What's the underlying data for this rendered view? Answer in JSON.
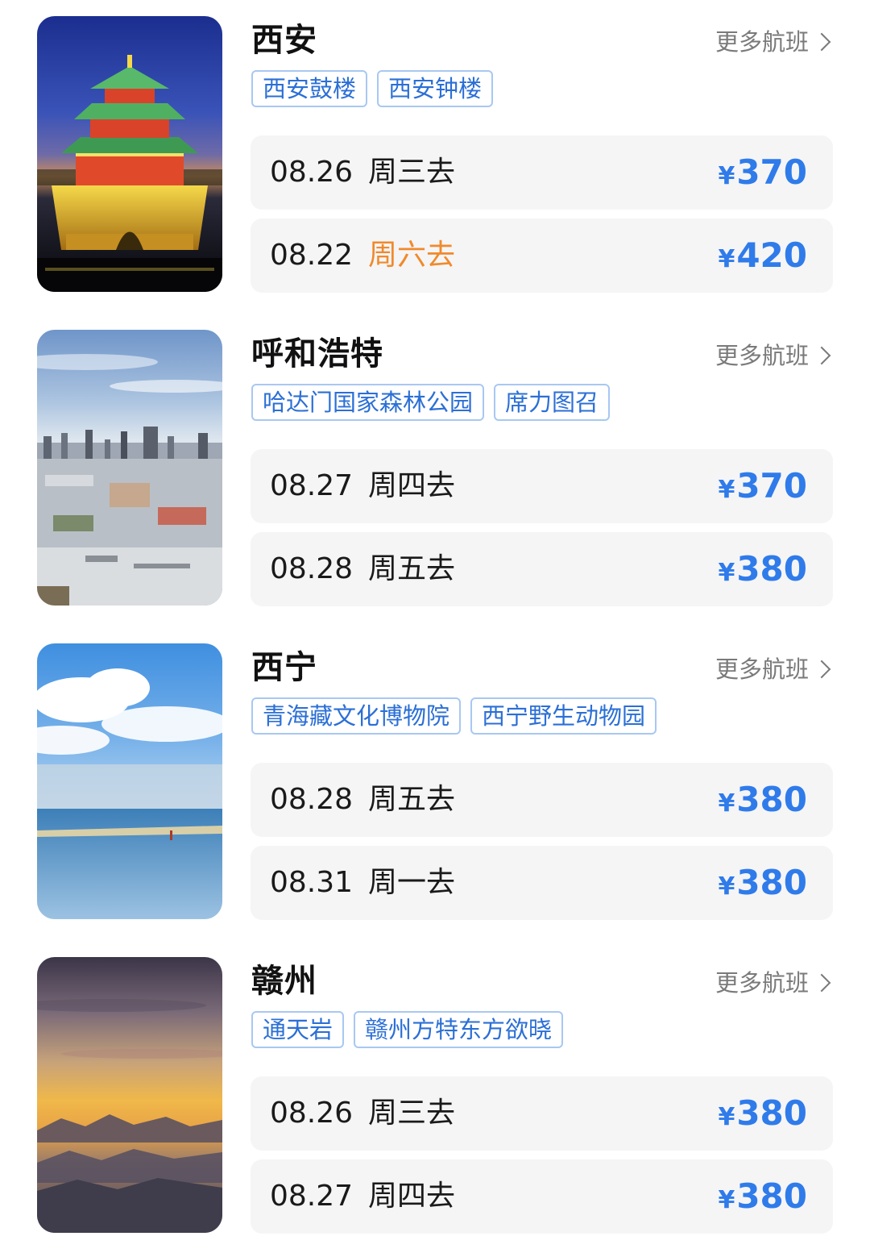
{
  "more_label": "更多航班",
  "colors": {
    "price": "#2f7bea",
    "weekend": "#f08a2c",
    "tag_text": "#2b6fd6",
    "tag_border": "#a8c8f2",
    "card_bg": "#f5f5f6"
  },
  "destinations": [
    {
      "city": "西安",
      "image": "xian-bell-tower-night-photo",
      "tags": [
        "西安鼓楼",
        "西安钟楼"
      ],
      "flights": [
        {
          "date": "08.26",
          "weekday": "周三去",
          "currency": "¥",
          "price": "370",
          "weekend": false
        },
        {
          "date": "08.22",
          "weekday": "周六去",
          "currency": "¥",
          "price": "420",
          "weekend": true
        }
      ]
    },
    {
      "city": "呼和浩特",
      "image": "hohhot-city-skyline-photo",
      "tags": [
        "哈达门国家森林公园",
        "席力图召"
      ],
      "flights": [
        {
          "date": "08.27",
          "weekday": "周四去",
          "currency": "¥",
          "price": "370",
          "weekend": false
        },
        {
          "date": "08.28",
          "weekday": "周五去",
          "currency": "¥",
          "price": "380",
          "weekend": false
        }
      ]
    },
    {
      "city": "西宁",
      "image": "xining-lake-sky-photo",
      "tags": [
        "青海藏文化博物院",
        "西宁野生动物园"
      ],
      "flights": [
        {
          "date": "08.28",
          "weekday": "周五去",
          "currency": "¥",
          "price": "380",
          "weekend": false
        },
        {
          "date": "08.31",
          "weekday": "周一去",
          "currency": "¥",
          "price": "380",
          "weekend": false
        }
      ]
    },
    {
      "city": "赣州",
      "image": "ganzhou-sunset-mountains-photo",
      "tags": [
        "通天岩",
        "赣州方特东方欲晓"
      ],
      "flights": [
        {
          "date": "08.26",
          "weekday": "周三去",
          "currency": "¥",
          "price": "380",
          "weekend": false
        },
        {
          "date": "08.27",
          "weekday": "周四去",
          "currency": "¥",
          "price": "380",
          "weekend": false
        }
      ]
    }
  ]
}
